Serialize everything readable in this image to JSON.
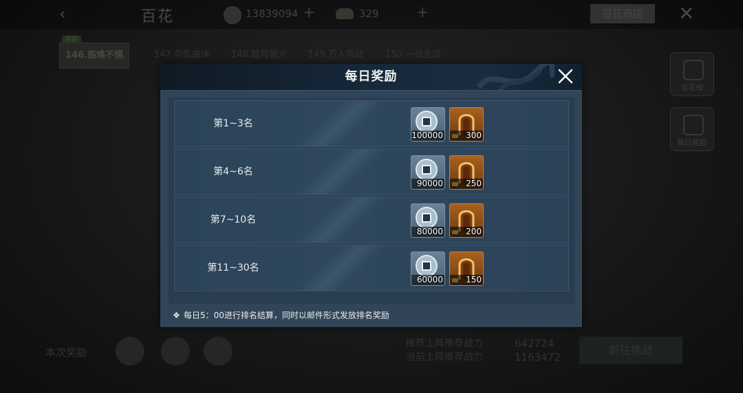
{
  "background": {
    "title": "百花",
    "coins": "13839094",
    "ingots": "329",
    "shop_button": "百花商店",
    "current_badge": "当前",
    "stage_tabs": [
      {
        "label": "146.临难不惧",
        "active": true
      },
      {
        "label": "147.杂乱曲体",
        "active": false
      },
      {
        "label": "148.踏月留光",
        "active": false
      },
      {
        "label": "149.万人阵敌",
        "active": false
      },
      {
        "label": "150.一战全成",
        "active": false
      }
    ],
    "side_buttons": [
      {
        "label": "百花榜"
      },
      {
        "label": "每日奖励"
      }
    ],
    "bottom": {
      "reward_label": "本次奖励",
      "rank_line1": "推荐上阵推荐战力",
      "rank_line2": "当前上阵推荐战力",
      "rank_value1": "642724",
      "rank_value2": "1163472",
      "go_button": "前往挑战"
    }
  },
  "modal": {
    "title": "每日奖励",
    "rows": [
      {
        "rank": "第1~3名",
        "coin": "100000",
        "gold": "300"
      },
      {
        "rank": "第4~6名",
        "coin": "90000",
        "gold": "250"
      },
      {
        "rank": "第7~10名",
        "coin": "80000",
        "gold": "200"
      },
      {
        "rank": "第11~30名",
        "coin": "60000",
        "gold": "150"
      }
    ],
    "footer": "每日5：00进行排名结算，同时以邮件形式发放排名奖励"
  },
  "colors": {
    "modal_body": "#324558",
    "modal_header": "#17283a",
    "row": "#2f475d",
    "gold_slot": "#a8611f"
  }
}
